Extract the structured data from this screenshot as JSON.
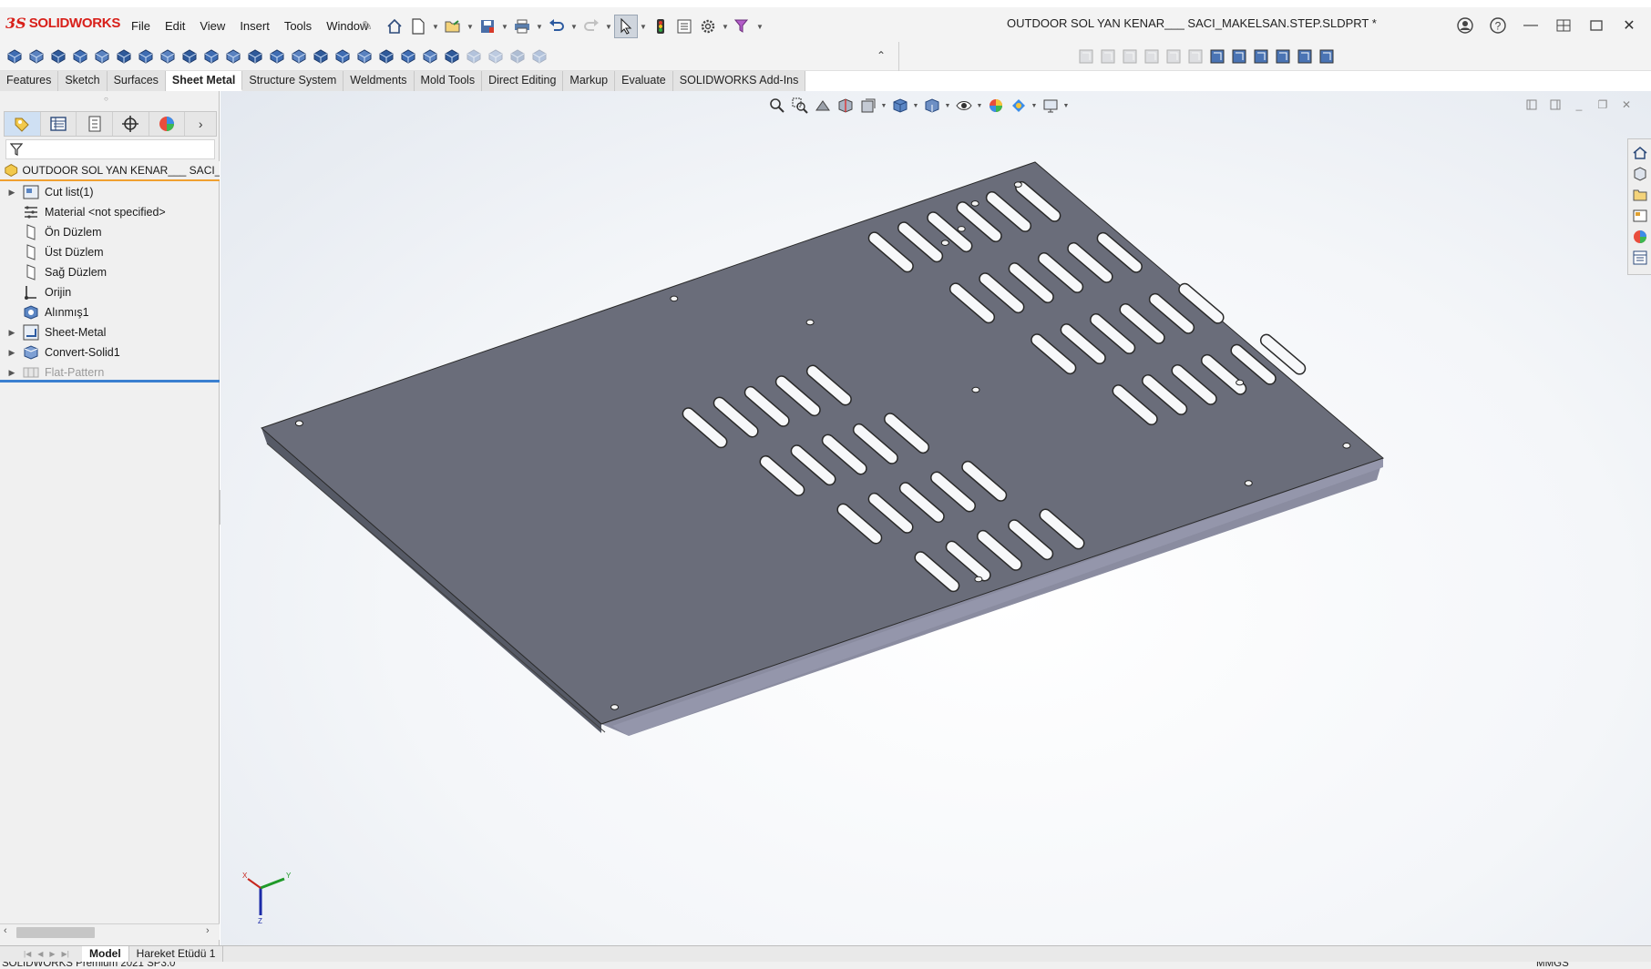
{
  "app": {
    "logo_prefix": "3S",
    "logo_name": "SOLIDWORKS",
    "document_title": "OUTDOOR SOL YAN KENAR___ SACI_MAKELSAN.STEP.SLDPRT *"
  },
  "menu": [
    "File",
    "Edit",
    "View",
    "Insert",
    "Tools",
    "Window"
  ],
  "tabs": [
    {
      "label": "Features",
      "active": false
    },
    {
      "label": "Sketch",
      "active": false
    },
    {
      "label": "Surfaces",
      "active": false
    },
    {
      "label": "Sheet Metal",
      "active": true
    },
    {
      "label": "Structure System",
      "active": false
    },
    {
      "label": "Weldments",
      "active": false
    },
    {
      "label": "Mold Tools",
      "active": false
    },
    {
      "label": "Direct Editing",
      "active": false
    },
    {
      "label": "Markup",
      "active": false
    },
    {
      "label": "Evaluate",
      "active": false
    },
    {
      "label": "SOLIDWORKS Add-Ins",
      "active": false
    }
  ],
  "feature_tree": {
    "root_label": "OUTDOOR SOL YAN KENAR___ SACI_MA",
    "items": [
      {
        "label": "Cut list(1)",
        "expandable": true,
        "icon": "cutlist-icon",
        "suppressed": false
      },
      {
        "label": "Material <not specified>",
        "expandable": false,
        "icon": "material-icon",
        "suppressed": false
      },
      {
        "label": "Ön Düzlem",
        "expandable": false,
        "icon": "plane-icon",
        "suppressed": false
      },
      {
        "label": "Üst Düzlem",
        "expandable": false,
        "icon": "plane-icon",
        "suppressed": false
      },
      {
        "label": "Sağ Düzlem",
        "expandable": false,
        "icon": "plane-icon",
        "suppressed": false
      },
      {
        "label": "Orijin",
        "expandable": false,
        "icon": "origin-icon",
        "suppressed": false
      },
      {
        "label": "Alınmış1",
        "expandable": false,
        "icon": "imported-body-icon",
        "suppressed": false
      },
      {
        "label": "Sheet-Metal",
        "expandable": true,
        "icon": "sheet-metal-icon",
        "suppressed": false
      },
      {
        "label": "Convert-Solid1",
        "expandable": true,
        "icon": "convert-solid-icon",
        "suppressed": false
      },
      {
        "label": "Flat-Pattern",
        "expandable": true,
        "icon": "flat-pattern-icon",
        "suppressed": true
      }
    ]
  },
  "bottom_tabs": [
    {
      "label": "Model",
      "active": true
    },
    {
      "label": "Hareket Etüdü 1",
      "active": false
    }
  ],
  "status": {
    "text": "SOLIDWORKS Premium 2021 SP3.0",
    "units": "MMGS"
  },
  "triad": {
    "x": "X",
    "y": "Y",
    "z": "Z"
  },
  "colors": {
    "brand_red": "#d8201a",
    "part_top": "#6a6d7a",
    "part_edge": "#7a7d90",
    "active_tab": "#ffffff",
    "rollback_bar": "#3a7fd0"
  }
}
